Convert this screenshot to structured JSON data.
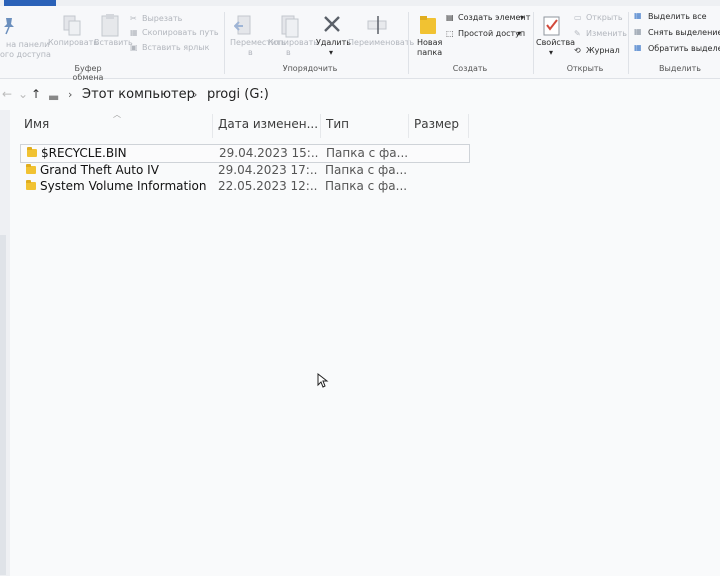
{
  "ribbon": {
    "clipboard": {
      "pin_label_1": "на панели",
      "pin_label_2": "ого доступа",
      "copy_label": "Копировать",
      "paste_label": "Вставить",
      "cut_label": "Вырезать",
      "copy_path_label": "Скопировать путь",
      "paste_shortcut_label": "Вставить ярлык",
      "group_label": "Буфер обмена"
    },
    "organize": {
      "move_to_label_1": "Переместить",
      "move_to_label_2": "в",
      "copy_to_label_1": "Копировать",
      "copy_to_label_2": "в",
      "delete_label": "Удалить",
      "rename_label": "Переименовать",
      "group_label": "Упорядочить"
    },
    "create": {
      "new_folder_label_1": "Новая",
      "new_folder_label_2": "папка",
      "new_item_label": "Создать элемент",
      "easy_access_label": "Простой доступ",
      "group_label": "Создать"
    },
    "open": {
      "properties_label": "Свойства",
      "open_label": "Открыть",
      "edit_label": "Изменить",
      "history_label": "Журнал",
      "group_label": "Открыть"
    },
    "select": {
      "select_all_label": "Выделить все",
      "select_none_label": "Снять выделение",
      "invert_label": "Обратить выделение",
      "group_label": "Выделить"
    }
  },
  "address": {
    "crumbs": [
      "Этот компьютер",
      "progi (G:)"
    ]
  },
  "columns": {
    "name": "Имя",
    "date": "Дата изменен...",
    "type": "Тип",
    "size": "Размер"
  },
  "files": [
    {
      "name": "$RECYCLE.BIN",
      "date": "29.04.2023 15:...",
      "type": "Папка с фа..."
    },
    {
      "name": "Grand Theft Auto IV",
      "date": "29.04.2023 17:...",
      "type": "Папка с фа..."
    },
    {
      "name": "System Volume Information",
      "date": "22.05.2023 12:...",
      "type": "Папка с фа..."
    }
  ]
}
